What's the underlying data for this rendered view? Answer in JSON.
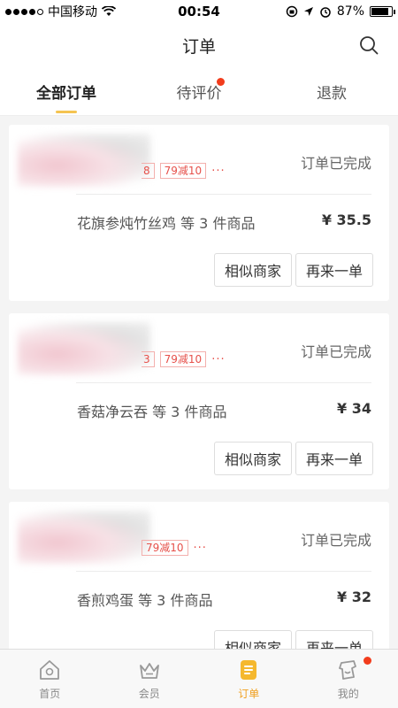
{
  "status_bar": {
    "carrier": "中国移动",
    "time": "00:54",
    "battery": "87%",
    "battery_level": 0.87
  },
  "header": {
    "title": "订单"
  },
  "tabs": [
    {
      "label": "全部订单",
      "active": true
    },
    {
      "label": "待评价",
      "badge": true
    },
    {
      "label": "退款"
    }
  ],
  "orders": [
    {
      "promo_tags": [
        "8",
        "79减10"
      ],
      "status": "订单已完成",
      "items": "花旗参炖竹丝鸡  等 3 件商品",
      "price": "¥ 35.5",
      "similar_label": "相似商家",
      "reorder_label": "再来一单"
    },
    {
      "promo_tags": [
        "3",
        "79减10"
      ],
      "status": "订单已完成",
      "items": "香菇净云吞  等 3 件商品",
      "price": "¥ 34",
      "similar_label": "相似商家",
      "reorder_label": "再来一单"
    },
    {
      "promo_tags": [
        "",
        "79减10"
      ],
      "status": "订单已完成",
      "items": "香煎鸡蛋  等 3 件商品",
      "price": "¥ 32",
      "similar_label": "相似商家",
      "reorder_label": "再来一单"
    }
  ],
  "promo_more": "···",
  "bottom_nav": [
    {
      "label": "首页",
      "icon": "home-icon"
    },
    {
      "label": "会员",
      "icon": "crown-icon"
    },
    {
      "label": "订单",
      "icon": "order-icon",
      "active": true
    },
    {
      "label": "我的",
      "icon": "profile-icon",
      "badge": true
    }
  ],
  "colors": {
    "accent": "#f5c451",
    "badge_red": "#f23c1c",
    "promo_red": "#e6504a"
  }
}
